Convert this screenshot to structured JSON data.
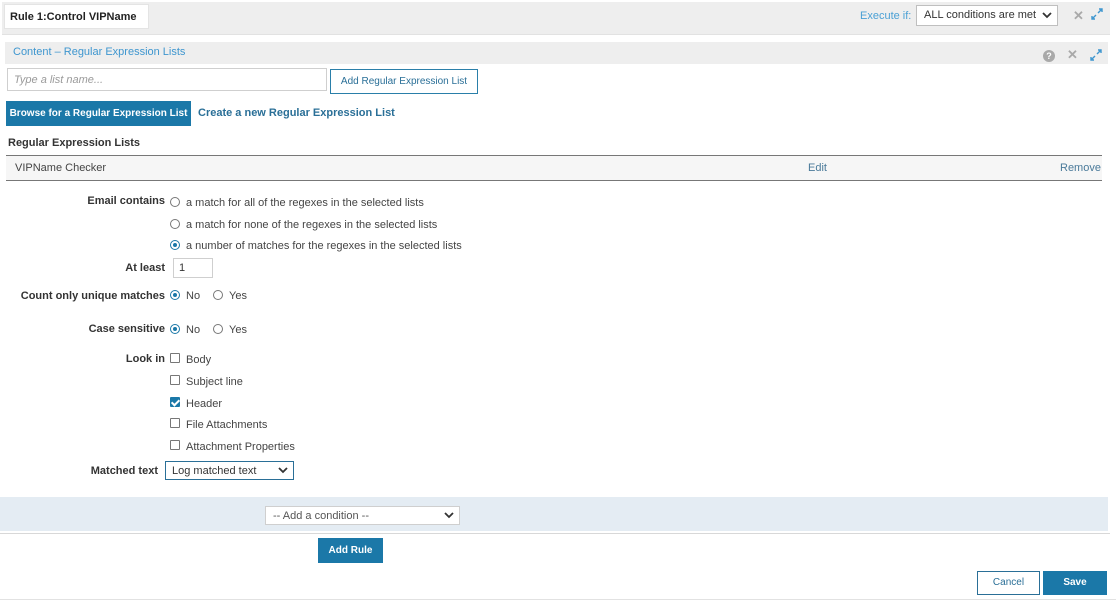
{
  "rule": {
    "name": "Rule 1:Control VIPName",
    "execute_label": "Execute if:",
    "execute_value": "ALL conditions are met"
  },
  "panel": {
    "title": "Content – Regular Expression Lists",
    "list_name_placeholder": "Type a list name...",
    "add_list_label": "Add Regular Expression List",
    "tabs": {
      "browse": "Browse for a Regular Expression List",
      "create": "Create a new Regular Expression List"
    },
    "lists_heading": "Regular Expression Lists",
    "lists": [
      {
        "name": "VIPName Checker",
        "edit": "Edit",
        "remove": "Remove"
      }
    ]
  },
  "form": {
    "email_contains_label": "Email contains",
    "email_contains_options": [
      {
        "label": "a match for all of the regexes in the selected lists",
        "selected": false
      },
      {
        "label": "a match for none of the regexes in the selected lists",
        "selected": false
      },
      {
        "label": "a number of matches for the regexes in the selected lists",
        "selected": true
      }
    ],
    "at_least_label": "At least",
    "at_least_value": "1",
    "unique_label": "Count only unique matches",
    "case_label": "Case sensitive",
    "no_label": "No",
    "yes_label": "Yes",
    "unique_value": "No",
    "case_value": "No",
    "look_in_label": "Look in",
    "look_in_options": [
      {
        "label": "Body",
        "checked": false
      },
      {
        "label": "Subject line",
        "checked": false
      },
      {
        "label": "Header",
        "checked": true
      },
      {
        "label": "File Attachments",
        "checked": false
      },
      {
        "label": "Attachment Properties",
        "checked": false
      }
    ],
    "matched_text_label": "Matched text",
    "matched_text_value": "Log matched text"
  },
  "condition_placeholder": "-- Add a condition --",
  "add_rule_label": "Add Rule",
  "cancel_label": "Cancel",
  "save_label": "Save",
  "colors": {
    "primary": "#1b78a8",
    "link": "#3e96cf",
    "panel_bg": "#eeeeee",
    "condition_bg": "#e4ecf3"
  }
}
